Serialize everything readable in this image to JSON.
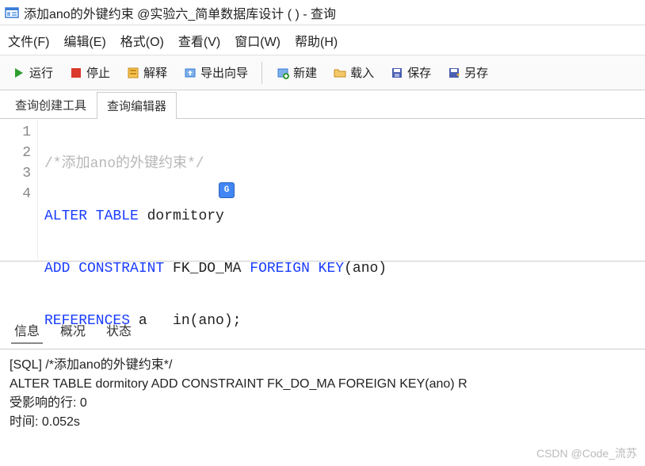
{
  "titlebar": {
    "text": "添加ano的外键约束 @实验六_简单数据库设计 (        ) - 查询"
  },
  "menubar": {
    "file": "文件(F)",
    "edit": "编辑(E)",
    "format": "格式(O)",
    "view": "查看(V)",
    "window": "窗口(W)",
    "help": "帮助(H)"
  },
  "toolbar": {
    "run": "运行",
    "stop": "停止",
    "explain": "解释",
    "export": "导出向导",
    "new": "新建",
    "load": "载入",
    "save": "保存",
    "saveas": "另存"
  },
  "tabs": {
    "builder": "查询创建工具",
    "editor": "查询编辑器"
  },
  "editor": {
    "gutter": [
      "1",
      "2",
      "3",
      "4"
    ],
    "line1_comment": "/*添加ano的外键约束*/",
    "line2_kw": "ALTER TABLE",
    "line2_plain": " dormitory",
    "line3_kw1": "ADD CONSTRAINT",
    "line3_plain1": " FK_DO_MA ",
    "line3_kw2": "FOREIGN KEY",
    "line3_plain2": "(ano)",
    "line4_kw": "REFERENCES",
    "line4_plain_a": " a",
    "line4_plain_b": "   in(ano);"
  },
  "bottomTabs": {
    "info": "信息",
    "profile": "概况",
    "status": "状态"
  },
  "output": {
    "line1": "[SQL] /*添加ano的外键约束*/",
    "line2": "ALTER TABLE dormitory ADD CONSTRAINT FK_DO_MA FOREIGN KEY(ano) R",
    "line3": "受影响的行: 0",
    "line4": "时间: 0.052s"
  },
  "watermark": "CSDN @Code_流苏"
}
